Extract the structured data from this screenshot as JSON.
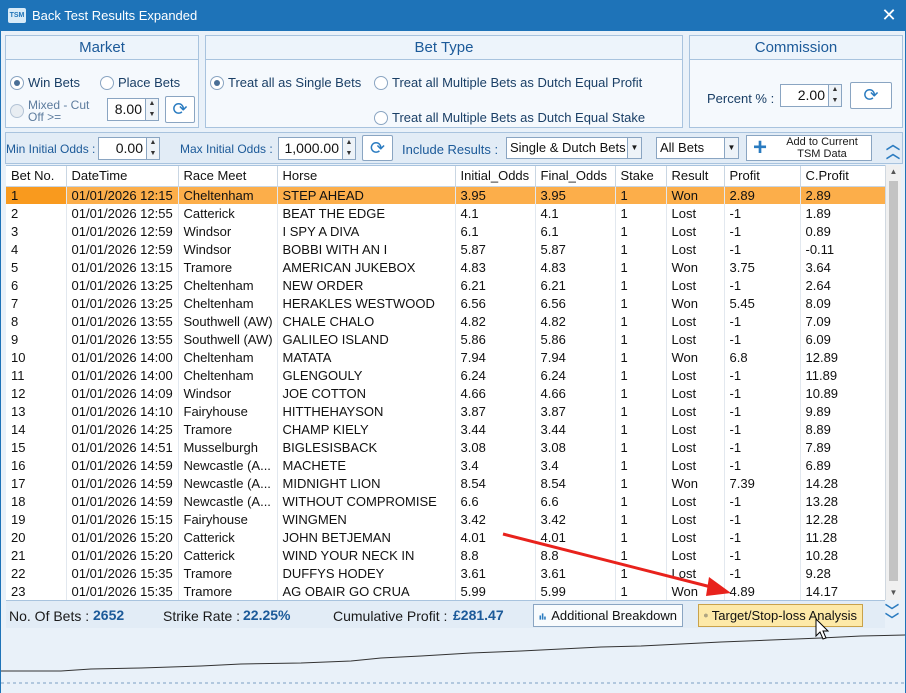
{
  "window": {
    "title": "Back Test Results Expanded",
    "logo_text": "TSM",
    "close_glyph": "✕"
  },
  "market": {
    "header": "Market",
    "win_bets": "Win Bets",
    "place_bets": "Place Bets",
    "mixed_line1": "Mixed - Cut",
    "mixed_line2": "Off >=",
    "mixed_value": "8.00"
  },
  "bet_type": {
    "header": "Bet Type",
    "single": "Treat all as Single Bets",
    "dutch_profit": "Treat all Multiple Bets as Dutch Equal Profit",
    "dutch_stake": "Treat all Multiple Bets as Dutch Equal Stake"
  },
  "commission": {
    "header": "Commission",
    "percent_label": "Percent % :",
    "percent_value": "2.00"
  },
  "filters": {
    "min_label": "Min Initial Odds :",
    "min_value": "0.00",
    "max_label": "Max Initial Odds :",
    "max_value": "1,000.00",
    "include_label": "Include Results :",
    "include_value": "Single & Dutch Bets",
    "bets_value": "All Bets",
    "add_line1": "Add to Current",
    "add_line2": "TSM Data"
  },
  "columns": [
    "Bet No.",
    "DateTime",
    "Race Meet",
    "Horse",
    "Initial_Odds",
    "Final_Odds",
    "Stake",
    "Result",
    "Profit",
    "C.Profit"
  ],
  "rows": [
    [
      "1",
      "01/01/2026 12:15",
      "Cheltenham",
      "STEP AHEAD",
      "3.95",
      "3.95",
      "1",
      "Won",
      "2.89",
      "2.89"
    ],
    [
      "2",
      "01/01/2026 12:55",
      "Catterick",
      "BEAT THE EDGE",
      "4.1",
      "4.1",
      "1",
      "Lost",
      "-1",
      "1.89"
    ],
    [
      "3",
      "01/01/2026 12:59",
      "Windsor",
      "I SPY A DIVA",
      "6.1",
      "6.1",
      "1",
      "Lost",
      "-1",
      "0.89"
    ],
    [
      "4",
      "01/01/2026 12:59",
      "Windsor",
      "BOBBI WITH AN I",
      "5.87",
      "5.87",
      "1",
      "Lost",
      "-1",
      "-0.11"
    ],
    [
      "5",
      "01/01/2026 13:15",
      "Tramore",
      "AMERICAN JUKEBOX",
      "4.83",
      "4.83",
      "1",
      "Won",
      "3.75",
      "3.64"
    ],
    [
      "6",
      "01/01/2026 13:25",
      "Cheltenham",
      "NEW ORDER",
      "6.21",
      "6.21",
      "1",
      "Lost",
      "-1",
      "2.64"
    ],
    [
      "7",
      "01/01/2026 13:25",
      "Cheltenham",
      "HERAKLES WESTWOOD",
      "6.56",
      "6.56",
      "1",
      "Won",
      "5.45",
      "8.09"
    ],
    [
      "8",
      "01/01/2026 13:55",
      "Southwell (AW)",
      "CHALE CHALO",
      "4.82",
      "4.82",
      "1",
      "Lost",
      "-1",
      "7.09"
    ],
    [
      "9",
      "01/01/2026 13:55",
      "Southwell (AW)",
      "GALILEO ISLAND",
      "5.86",
      "5.86",
      "1",
      "Lost",
      "-1",
      "6.09"
    ],
    [
      "10",
      "01/01/2026 14:00",
      "Cheltenham",
      "MATATA",
      "7.94",
      "7.94",
      "1",
      "Won",
      "6.8",
      "12.89"
    ],
    [
      "11",
      "01/01/2026 14:00",
      "Cheltenham",
      "GLENGOULY",
      "6.24",
      "6.24",
      "1",
      "Lost",
      "-1",
      "11.89"
    ],
    [
      "12",
      "01/01/2026 14:09",
      "Windsor",
      "JOE COTTON",
      "4.66",
      "4.66",
      "1",
      "Lost",
      "-1",
      "10.89"
    ],
    [
      "13",
      "01/01/2026 14:10",
      "Fairyhouse",
      "HITTHEHAYSON",
      "3.87",
      "3.87",
      "1",
      "Lost",
      "-1",
      "9.89"
    ],
    [
      "14",
      "01/01/2026 14:25",
      "Tramore",
      "CHAMP KIELY",
      "3.44",
      "3.44",
      "1",
      "Lost",
      "-1",
      "8.89"
    ],
    [
      "15",
      "01/01/2026 14:51",
      "Musselburgh",
      "BIGLESISBACK",
      "3.08",
      "3.08",
      "1",
      "Lost",
      "-1",
      "7.89"
    ],
    [
      "16",
      "01/01/2026 14:59",
      "Newcastle (A...",
      "MACHETE",
      "3.4",
      "3.4",
      "1",
      "Lost",
      "-1",
      "6.89"
    ],
    [
      "17",
      "01/01/2026 14:59",
      "Newcastle (A...",
      "MIDNIGHT LION",
      "8.54",
      "8.54",
      "1",
      "Won",
      "7.39",
      "14.28"
    ],
    [
      "18",
      "01/01/2026 14:59",
      "Newcastle (A...",
      "WITHOUT COMPROMISE",
      "6.6",
      "6.6",
      "1",
      "Lost",
      "-1",
      "13.28"
    ],
    [
      "19",
      "01/01/2026 15:15",
      "Fairyhouse",
      "WINGMEN",
      "3.42",
      "3.42",
      "1",
      "Lost",
      "-1",
      "12.28"
    ],
    [
      "20",
      "01/01/2026 15:20",
      "Catterick",
      "JOHN BETJEMAN",
      "4.01",
      "4.01",
      "1",
      "Lost",
      "-1",
      "11.28"
    ],
    [
      "21",
      "01/01/2026 15:20",
      "Catterick",
      "WIND YOUR NECK IN",
      "8.8",
      "8.8",
      "1",
      "Lost",
      "-1",
      "10.28"
    ],
    [
      "22",
      "01/01/2026 15:35",
      "Tramore",
      "DUFFYS HODEY",
      "3.61",
      "3.61",
      "1",
      "Lost",
      "-1",
      "9.28"
    ],
    [
      "23",
      "01/01/2026 15:35",
      "Tramore",
      "AG OBAIR GO CRUA",
      "5.99",
      "5.99",
      "1",
      "Won",
      "4.89",
      "14.17"
    ]
  ],
  "status": {
    "bets_label": "No. Of Bets :",
    "bets_value": "2652",
    "strike_label": "Strike Rate :",
    "strike_value": "22.25%",
    "profit_label": "Cumulative Profit :",
    "profit_value": "£281.47",
    "breakdown_label": "Additional Breakdown",
    "target_label": "Target/Stop-loss Analysis"
  },
  "icons": [
    "refresh-icon",
    "plus-icon",
    "chevron-up-double-icon",
    "chevron-down-double-icon",
    "bar-chart-icon",
    "target-icon",
    "cursor-icon"
  ],
  "colors": {
    "titlebar": "#1e73b8",
    "selected_row": "#fcae4a",
    "accent_text": "#1c5a99",
    "highlight_button": "#fde9a8",
    "annotation_arrow": "#e8221c"
  }
}
